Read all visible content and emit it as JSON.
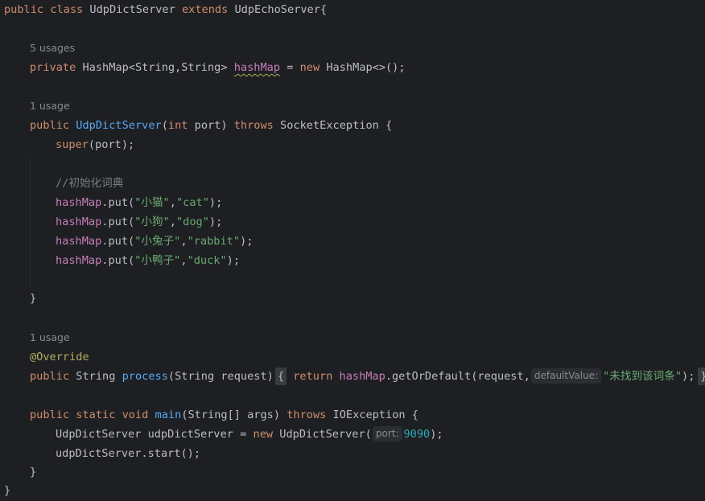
{
  "code": {
    "kw_public": "public",
    "kw_class": "class",
    "kw_extends": "extends",
    "kw_private": "private",
    "kw_new": "new",
    "kw_int": "int",
    "kw_throws": "throws",
    "kw_super": "super",
    "kw_return": "return",
    "kw_static": "static",
    "kw_void": "void",
    "class_name": "UdpDictServer",
    "parent_class": "UdpEchoServer",
    "lbrace": "{",
    "rbrace": "}",
    "usages_5": "5 usages",
    "usages_1a": "1 usage",
    "usages_1b": "1 usage",
    "field_type": "HashMap<String,String>",
    "field_name": "hashMap",
    "field_init": "HashMap<>();",
    "equals": " = ",
    "ctor_name": "UdpDictServer",
    "ctor_param_open": "(",
    "ctor_param_rest": " port) ",
    "exception1": "SocketException {",
    "super_args": "(port);",
    "comment": "//初始化词典",
    "put_fn": ".put(",
    "put_sep": ",",
    "put_end": ");",
    "entries": [
      {
        "key": "\"小猫\"",
        "value": "\"cat\""
      },
      {
        "key": "\"小狗\"",
        "value": "\"dog\""
      },
      {
        "key": "\"小兔子\"",
        "value": "\"rabbit\""
      },
      {
        "key": "\"小鸭子\"",
        "value": "\"duck\""
      }
    ],
    "annotation": "@Override",
    "string_type": "String",
    "process_name": "process",
    "process_params": "(String request)",
    "get_or_default": ".getOrDefault(request,",
    "hint_default": "defaultValue:",
    "default_str": "\"未找到该词条\"",
    "stmt_end": ");",
    "main_name": "main",
    "main_params": "(String[] args) ",
    "exception2": "IOException {",
    "local_decl": "UdpDictServer udpDictServer = ",
    "ctor_call": "UdpDictServer(",
    "hint_port": "port:",
    "port_value": "9090",
    "call_end": ");",
    "start_call": "udpDictServer.start();"
  }
}
